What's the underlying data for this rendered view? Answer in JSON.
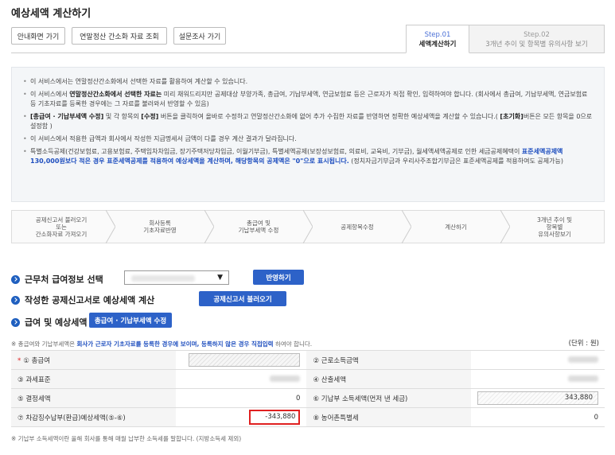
{
  "page_title": "예상세액 계산하기",
  "top_buttons": [
    "안내화면 가기",
    "연말정산 간소화 자료 조회",
    "설문조사 가기"
  ],
  "step_tabs": [
    {
      "step": "Step.01",
      "label": "세액계산하기"
    },
    {
      "step": "Step.02",
      "label": "3개년 추이 및 항목별 유의사항 보기"
    }
  ],
  "info": {
    "i1": "이 서비스에서는 연말정산간소화에서 선택한 자료를 활용하여 계산할 수 있습니다.",
    "i2a": "이 서비스에서 ",
    "i2b": "연말정산간소화에서 선택한 자료는",
    "i2c": " 미리 채워드리지만 공제대상 부양가족, 총급여, 기납부세액, 연금보험료 등은 근로자가 직접 확인, 입력하여야 합니다. (회사에서 총급여, 기납부세액, 연금보험료 등 기초자료를 등록한 경우에는 그 자료를 불러와서 반영할 수 있음)",
    "i3a": "[총급여 · 기납부세액 수정]",
    "i3b": " 및 각 항목의 ",
    "i3c": "[수정]",
    "i3d": " 버튼을 클릭하여 올바로 수정하고 연말정산간소화에 없어 추가 수집한 자료를 반영하면 정확한 예상세액을 계산할 수 있습니다.( ",
    "i3e": "[초기화]",
    "i3f": "버튼은 모든 항목을 0으로 설정함 )",
    "i4": "이 서비스에서 적용한 급액과 회사에서 작성한 지급명세서 금액이 다를 경우 계산 결과가 달라집니다.",
    "i5a": "특별소득공제(건강보험료, 고용보험료, 주택임차차입금, 장기주택저당차입금, 이월기부금), 특별세액공제(보장성보험료, 의료비, 교육비, 기부금), 월세액세액공제로 인한 세금공제혜택이 ",
    "i5b": "표준세액공제액 130,000원보다 적은 경우 표준세액공제를 적용하여 예상세액을 계산하며, 해당항목의 공제액은 \"0\"으로 표시됩니다.",
    "i5c": " (정치자금기부금과 우리사주조합기부금은 표준세액공제를 적용하여도 공제가능)"
  },
  "process_steps": [
    [
      "공제신고서 불러오기",
      "또는",
      "간소화자료 가져오기"
    ],
    [
      "회사등록",
      "기초자료반영"
    ],
    [
      "총급여 및",
      "기납부세액 수정"
    ],
    [
      "공제항목수정"
    ],
    [
      "계산하기"
    ],
    [
      "3개년 추이 및",
      "항목별",
      "유의사항보기"
    ]
  ],
  "sections": {
    "workplace": "근무처 급여정보 선택",
    "apply_btn": "반영하기",
    "calc": "작성한 공제신고서로 예상세액 계산",
    "load_btn": "공제신고서 불러오기",
    "salary": "급여 및 예상세액",
    "edit_btn": "총급여 · 기납부세액 수정"
  },
  "note_top": {
    "a": "※ 총급여와 기납부세액은 ",
    "b": "회사가 근로자 기초자료를 등록한 경우에 보이며, 등록하지 않은 경우 직접입력",
    "c": " 하여야 합니다."
  },
  "unit": "(단위 : 원)",
  "table": {
    "r1": {
      "l1": "① 총급여",
      "l2": "② 근로소득금액"
    },
    "r2": {
      "l1": "③ 과세표준",
      "l2": "④ 산출세액"
    },
    "r3": {
      "l1": "⑤ 결정세액",
      "v1": "0",
      "l2": "⑥ 기납부 소득세액(먼저 낸 세금)",
      "v2": "343,880"
    },
    "r4": {
      "l1": "⑦ 차감징수납부(환급)예상세액(⑤-⑥)",
      "v1": "-343,880",
      "l2": "⑧ 농어촌특별세",
      "v2": "0"
    }
  },
  "note_bottom": "※ 기납부 소득세액이란 올해 회사를 통해 매월 납부한 소득세를 말합니다. (지방소득세 제외)",
  "colors": {
    "accent": "#2d62c8",
    "highlight": "#e02020"
  }
}
